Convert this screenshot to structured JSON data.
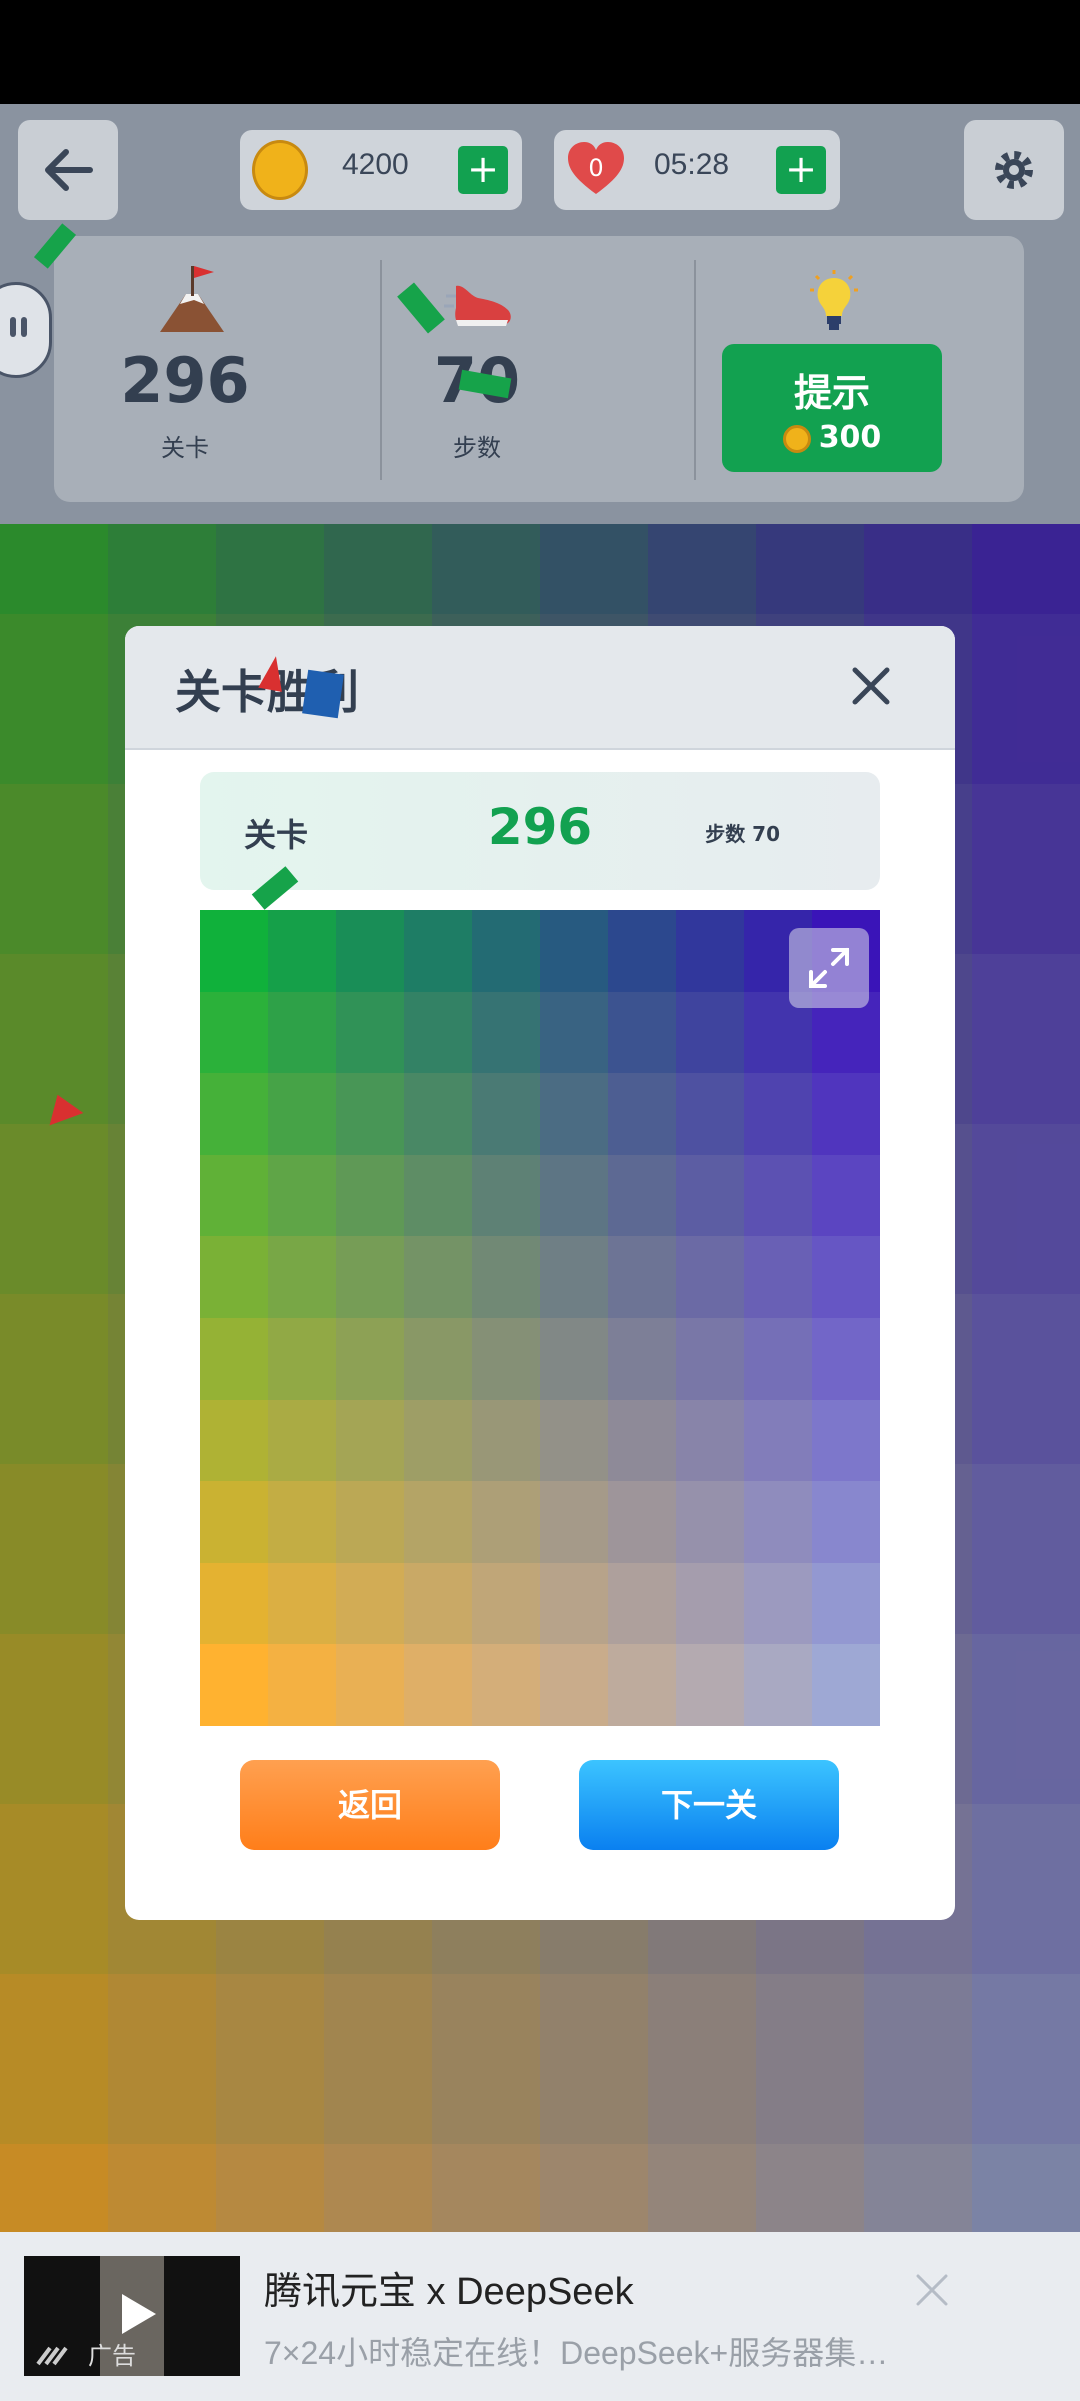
{
  "header": {
    "coins": "4200",
    "timer": "05:28",
    "plus_label": "+"
  },
  "stats": {
    "level_value": "296",
    "level_label": "关卡",
    "steps_value": "70",
    "steps_label": "步数",
    "hint_label": "提示",
    "hint_cost": "300"
  },
  "modal": {
    "title": "关卡胜利",
    "level_label": "关卡",
    "level_value": "296",
    "steps_text": "步数 70",
    "back_label": "返回",
    "next_label": "下一关"
  },
  "board": {
    "rows": 10,
    "cols": 10,
    "corner_colors": {
      "top_left": "#10b13b",
      "top_right": "#3a14b8",
      "bottom_left": "#ffb230",
      "bottom_right": "#9ea8d4"
    }
  },
  "ad": {
    "title": "腾讯元宝 x DeepSeek",
    "description": "7×24小时稳定在线！DeepSeek+服务器集…",
    "badge": "广告"
  },
  "colors": {
    "accent_green": "#12a150",
    "orange_start": "#ff9c40",
    "orange_end": "#ff7e1a",
    "blue_start": "#3cc0ff",
    "blue_end": "#0a84f0",
    "text_dark": "#333f50"
  }
}
